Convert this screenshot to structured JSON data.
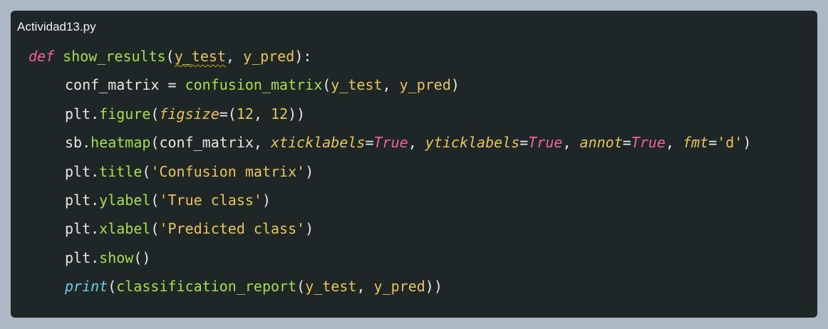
{
  "window": {
    "filename": "Actividad13.py"
  },
  "code": {
    "l1": {
      "def": "def",
      "name": "show_results",
      "open": "(",
      "p1": "y_test",
      "sep": ", ",
      "p2": "y_pred",
      "close": "):"
    },
    "l2": {
      "var": "conf_matrix",
      "eq": " = ",
      "fn": "confusion_matrix",
      "open": "(",
      "a1": "y_test",
      "sep": ", ",
      "a2": "y_pred",
      "close": ")"
    },
    "l3": {
      "obj": "plt.",
      "fn": "figure",
      "open": "(",
      "kw": "figsize",
      "eq": "=(",
      "n1": "12",
      "sep": ", ",
      "n2": "12",
      "close": "))"
    },
    "l4": {
      "obj": "sb.",
      "fn": "heatmap",
      "open": "(",
      "arg": "conf_matrix",
      "sep1": ", ",
      "k1": "xticklabels",
      "eq1": "=",
      "v1": "True",
      "sep2": ", ",
      "k2": "yticklabels",
      "eq2": "=",
      "v2": "True",
      "sep3": ", ",
      "k3": "annot",
      "eq3": "=",
      "v3": "True",
      "sep4": ", ",
      "k4": "fmt",
      "eq4": "=",
      "v4": "'d'",
      "close": ")"
    },
    "l5": {
      "obj": "plt.",
      "fn": "title",
      "open": "(",
      "str": "'Confusion matrix'",
      "close": ")"
    },
    "l6": {
      "obj": "plt.",
      "fn": "ylabel",
      "open": "(",
      "str": "'True class'",
      "close": ")"
    },
    "l7": {
      "obj": "plt.",
      "fn": "xlabel",
      "open": "(",
      "str": "'Predicted class'",
      "close": ")"
    },
    "l8": {
      "obj": "plt.",
      "fn": "show",
      "close": "()"
    },
    "l9": {
      "fn": "print",
      "open": "(",
      "inner": "classification_report",
      "open2": "(",
      "a1": "y_test",
      "sep": ", ",
      "a2": "y_pred",
      "close": "))"
    }
  },
  "colors": {
    "page_background": "#abb8c3",
    "editor_background": "#1f2626",
    "keyword": "#f0649a",
    "function": "#a6df4f",
    "parameter": "#e9c45c",
    "builtin": "#6fcde8",
    "text": "#e8e8e6"
  }
}
